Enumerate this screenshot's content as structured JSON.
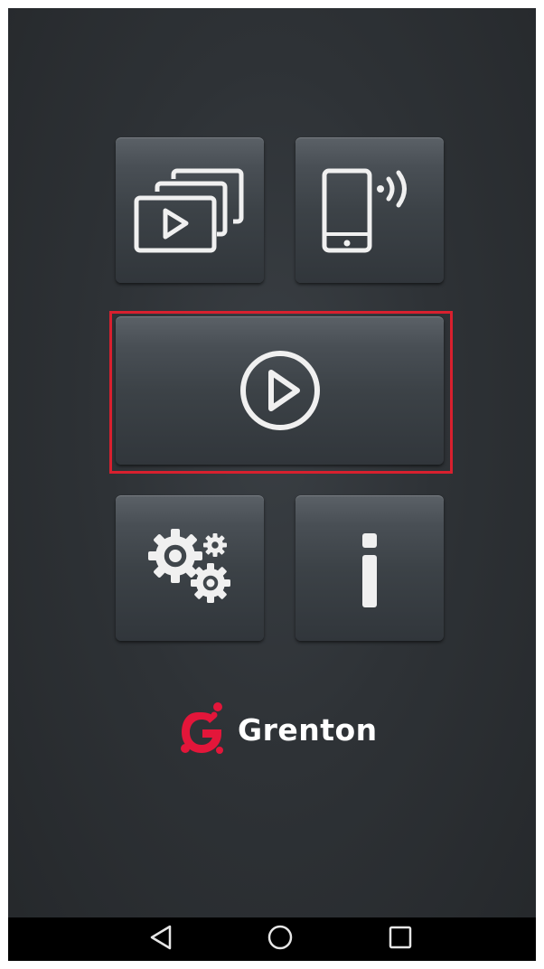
{
  "app": {
    "logo_text": "Grenton",
    "logo_color": "#e3163a"
  },
  "tiles": [
    {
      "id": "gallery",
      "icon": "slideshow-gallery-icon"
    },
    {
      "id": "device",
      "icon": "phone-wireless-icon"
    },
    {
      "id": "play",
      "icon": "play-circle-icon",
      "highlighted": true
    },
    {
      "id": "settings",
      "icon": "gears-icon"
    },
    {
      "id": "info",
      "icon": "info-icon"
    }
  ],
  "highlight_color": "#d8202e",
  "navbar": {
    "buttons": [
      "nav-back-icon",
      "nav-home-icon",
      "nav-recent-apps-icon"
    ]
  }
}
